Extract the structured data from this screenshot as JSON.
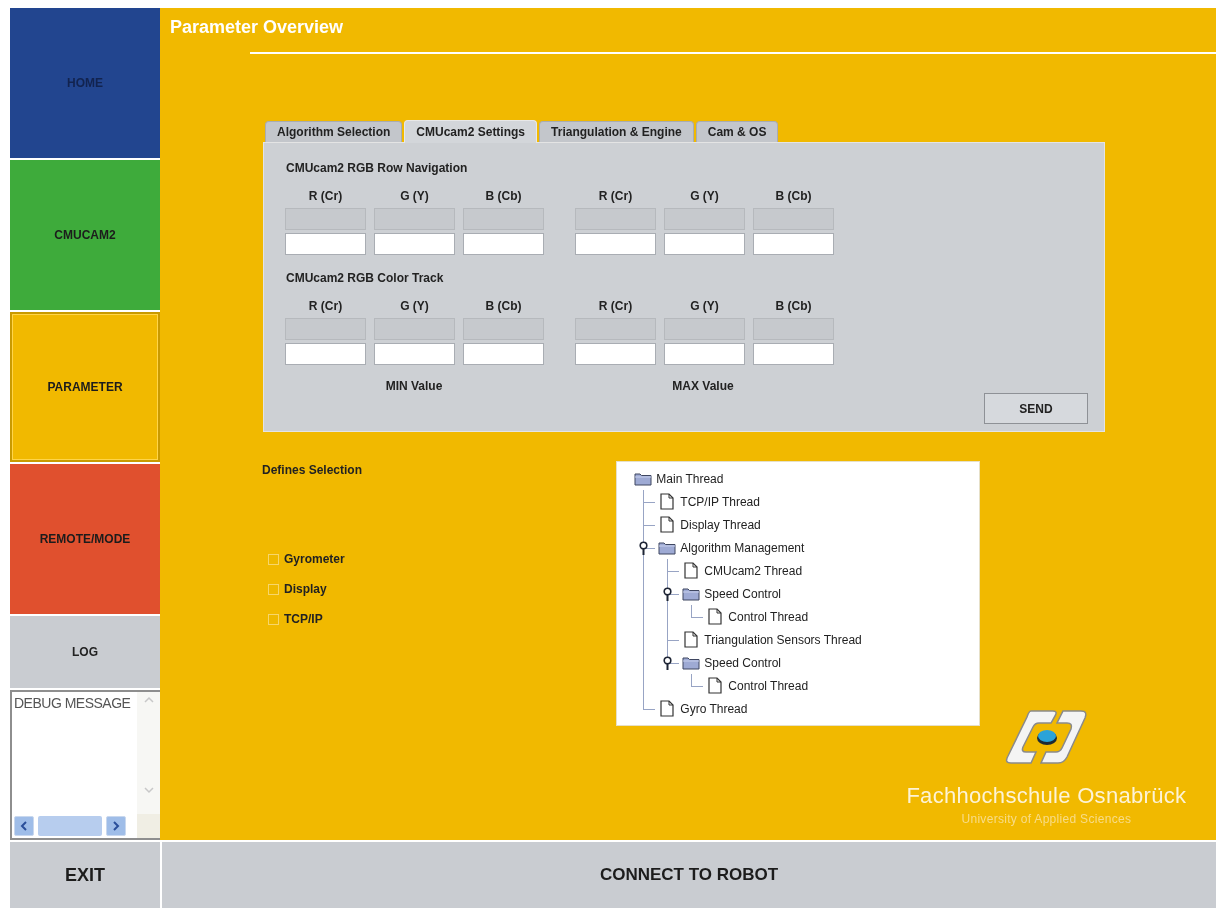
{
  "nav": [
    {
      "label": "HOME",
      "color": "#22458f",
      "selected": false
    },
    {
      "label": "CMUCAM2",
      "color": "#3eab3b",
      "selected": false
    },
    {
      "label": "PARAMETER",
      "color": "#f1b900",
      "selected": true
    },
    {
      "label": "REMOTE/MODE",
      "color": "#e0502e",
      "selected": false
    }
  ],
  "log": {
    "label": "LOG"
  },
  "debug": {
    "text": "DEBUG MESSAGE"
  },
  "title": "Parameter Overview",
  "tabs": [
    {
      "label": "Algorithm Selection",
      "selected": false
    },
    {
      "label": "CMUcam2 Settings",
      "selected": true
    },
    {
      "label": "Triangulation & Engine",
      "selected": false
    },
    {
      "label": "Cam & OS",
      "selected": false
    }
  ],
  "sections": [
    {
      "title": "CMUcam2 RGB Row Navigation",
      "columns": [
        "R (Cr)",
        "G (Y)",
        "B (Cb)",
        "R (Cr)",
        "G (Y)",
        "B (Cb)"
      ]
    },
    {
      "title": "CMUcam2 RGB Color Track",
      "columns": [
        "R (Cr)",
        "G (Y)",
        "B (Cb)",
        "R (Cr)",
        "G (Y)",
        "B (Cb)"
      ]
    }
  ],
  "value_labels": [
    "MIN Value",
    "MAX Value"
  ],
  "send": "SEND",
  "defines": {
    "title": "Defines Selection",
    "options": [
      {
        "label": "Gyrometer",
        "checked": false
      },
      {
        "label": "Display",
        "checked": false
      },
      {
        "label": "TCP/IP",
        "checked": false
      }
    ]
  },
  "tree": {
    "label": "Main Thread",
    "kind": "folder",
    "children": [
      {
        "label": "TCP/IP Thread",
        "kind": "file"
      },
      {
        "label": "Display Thread",
        "kind": "file"
      },
      {
        "label": "Algorithm Management",
        "kind": "folder",
        "expanded": true,
        "children": [
          {
            "label": "CMUcam2 Thread",
            "kind": "file"
          },
          {
            "label": "Speed Control",
            "kind": "folder",
            "expanded": true,
            "children": [
              {
                "label": "Control Thread",
                "kind": "file"
              }
            ]
          },
          {
            "label": "Triangulation Sensors Thread",
            "kind": "file"
          },
          {
            "label": "Speed Control",
            "kind": "folder",
            "expanded": true,
            "children": [
              {
                "label": "Control Thread",
                "kind": "file"
              }
            ]
          }
        ]
      },
      {
        "label": "Gyro Thread",
        "kind": "file"
      }
    ]
  },
  "logo": {
    "name": "Fachhochschule Osnabrück",
    "subtitle": "University of Applied Sciences"
  },
  "footer": {
    "exit": "EXIT",
    "connect": "CONNECT TO ROBOT"
  }
}
